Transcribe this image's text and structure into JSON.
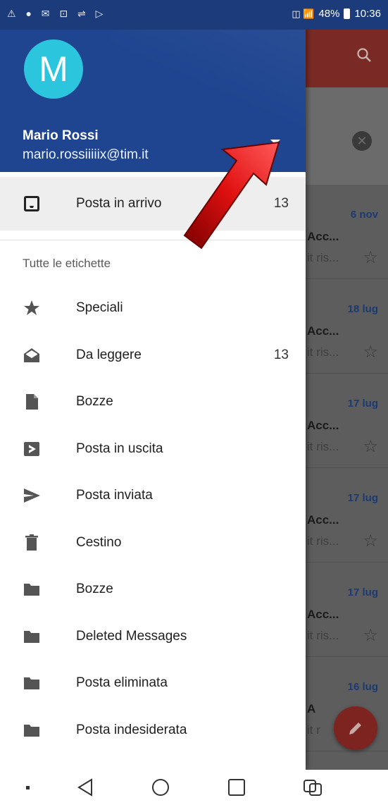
{
  "status_bar": {
    "left_icons": "⚠ ● ✉ ⊡ ⇌ ▷",
    "signal_text": "◫ 📶",
    "battery": "48%",
    "time": "10:36"
  },
  "account": {
    "avatar_letter": "M",
    "name": "Mario Rossi",
    "email": "mario.rossiiiiix@tim.it",
    "avatar_color": "#2cc5de",
    "header_color": "#1f4590"
  },
  "inbox": {
    "label": "Posta in arrivo",
    "count": "13",
    "icon": "inbox-icon"
  },
  "labels_section": {
    "title": "Tutte le etichette"
  },
  "menu_items": [
    {
      "label": "Speciali",
      "count": "",
      "icon": "star-icon"
    },
    {
      "label": "Da leggere",
      "count": "13",
      "icon": "open-mail-icon"
    },
    {
      "label": "Bozze",
      "count": "",
      "icon": "draft-icon"
    },
    {
      "label": "Posta in uscita",
      "count": "",
      "icon": "outbox-icon"
    },
    {
      "label": "Posta inviata",
      "count": "",
      "icon": "send-icon"
    },
    {
      "label": "Cestino",
      "count": "",
      "icon": "trash-icon"
    },
    {
      "label": "Bozze",
      "count": "",
      "icon": "folder-icon"
    },
    {
      "label": "Deleted Messages",
      "count": "",
      "icon": "folder-icon"
    },
    {
      "label": "Posta eliminata",
      "count": "",
      "icon": "folder-icon"
    },
    {
      "label": "Posta indesiderata",
      "count": "",
      "icon": "folder-icon"
    }
  ],
  "background_list": {
    "rows": [
      {
        "date": "6 nov",
        "sender": "Acc...",
        "snippet": "it ris..."
      },
      {
        "date": "18 lug",
        "sender": "Acc...",
        "snippet": "it ris..."
      },
      {
        "date": "17 lug",
        "sender": "Acc...",
        "snippet": "it ris..."
      },
      {
        "date": "17 lug",
        "sender": "Acc...",
        "snippet": "it ris..."
      },
      {
        "date": "17 lug",
        "sender": "Acc...",
        "snippet": "it ris..."
      },
      {
        "date": "16 lug",
        "sender": "A",
        "snippet": "it r"
      }
    ]
  },
  "nav_bar": {
    "buttons": [
      "dot-icon",
      "back-icon",
      "home-icon",
      "recents-icon",
      "dual-app-icon"
    ]
  }
}
